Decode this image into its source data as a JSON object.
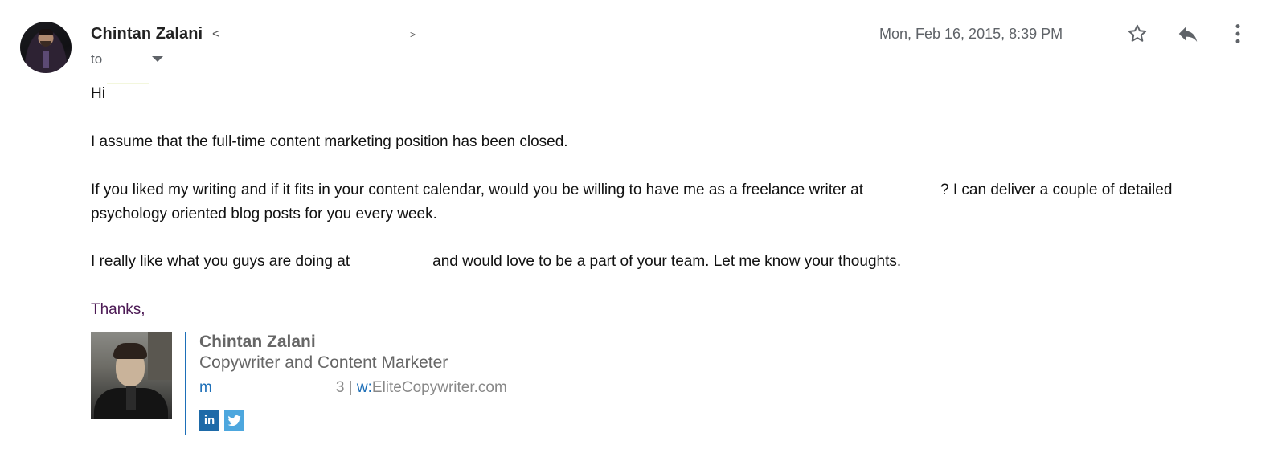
{
  "header": {
    "sender_name": "Chintan Zalani",
    "sender_addr_open": "<",
    "sender_addr_close": ">",
    "to_label": "to",
    "date": "Mon, Feb 16, 2015, 8:39 PM",
    "icons": [
      "star-icon",
      "reply-icon",
      "more-vert-icon",
      "chevron-down-icon"
    ]
  },
  "body": {
    "greeting": "Hi",
    "para1": "I assume that the full-time content marketing position has been closed.",
    "para2_part1": "If you liked my writing and if it fits in your content calendar, would you be willing to have me as a freelance writer at",
    "para2_part2": "? I can deliver a couple of detailed",
    "para2_line2": "psychology oriented blog posts for you every week.",
    "para3_part1": "I really like what you guys are doing at",
    "para3_part2": "and would love to be a part of your team. Let me know your thoughts.",
    "closing": "Thanks,"
  },
  "signature": {
    "name": "Chintan Zalani",
    "title": "Copywriter and Content Marketer",
    "m_label": "m",
    "m_tail": "3",
    "separator": " | ",
    "w_label": "w:",
    "website": "EliteCopywriter.com",
    "linkedin_glyph": "in",
    "accent_color": "#1d6fb8",
    "closing_color": "#4c1a55"
  }
}
